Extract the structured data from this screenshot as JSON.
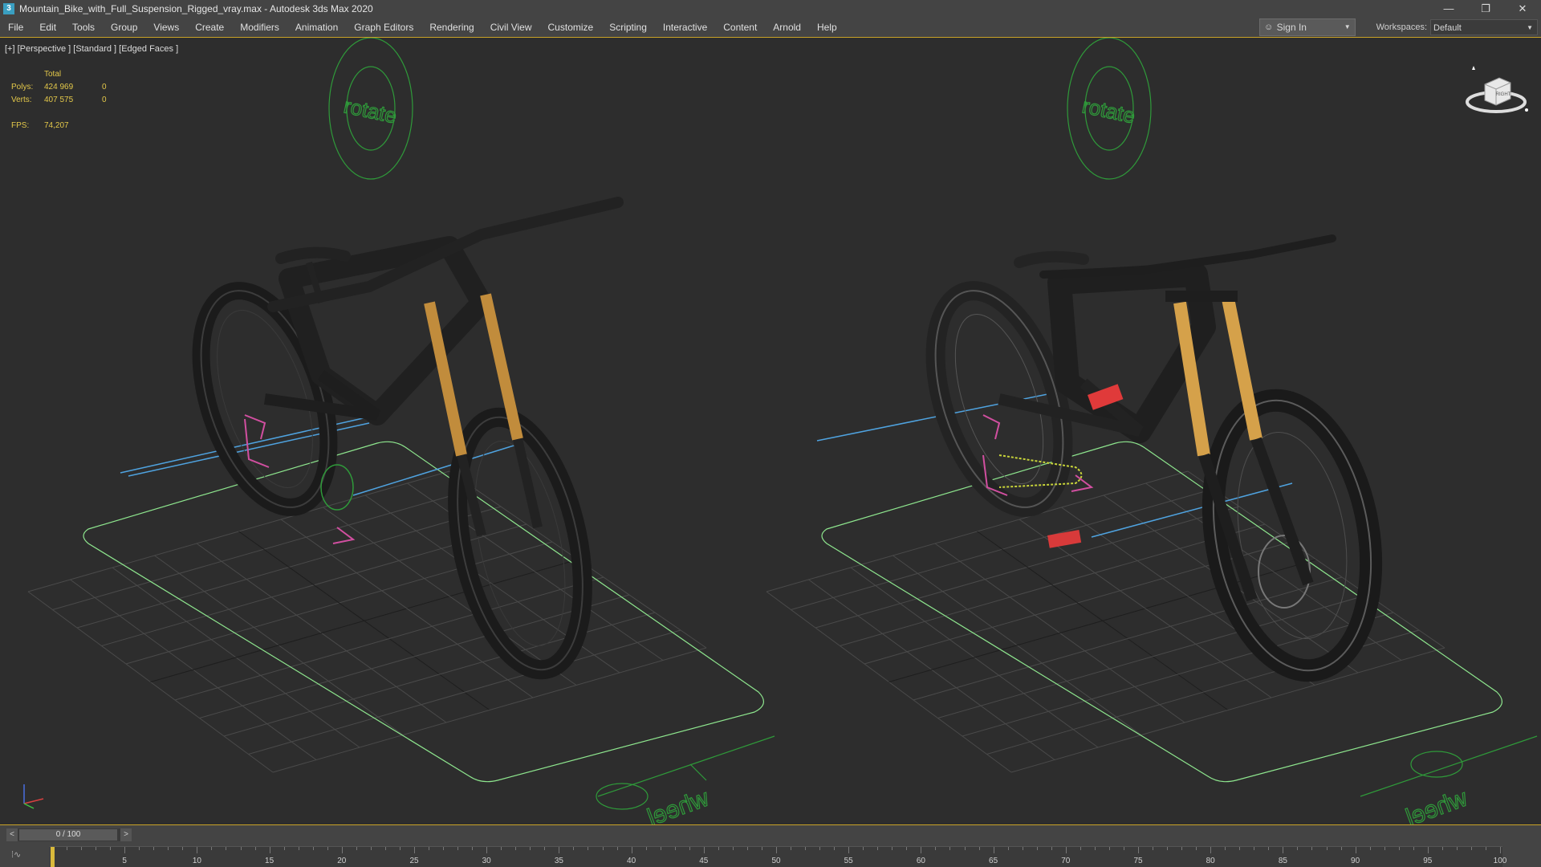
{
  "window": {
    "title": "Mountain_Bike_with_Full_Suspension_Rigged_vray.max - Autodesk 3ds Max 2020",
    "app_icon": "3",
    "controls": {
      "minimize": "—",
      "restore": "❐",
      "close": "✕"
    }
  },
  "menu": {
    "items": [
      "File",
      "Edit",
      "Tools",
      "Group",
      "Views",
      "Create",
      "Modifiers",
      "Animation",
      "Graph Editors",
      "Rendering",
      "Civil View",
      "Customize",
      "Scripting",
      "Interactive",
      "Content",
      "Arnold",
      "Help"
    ],
    "sign_in": "Sign In",
    "workspaces_label": "Workspaces:",
    "workspace_value": "Default"
  },
  "viewport": {
    "label": "[+] [Perspective ] [Standard ] [Edged Faces ]",
    "stats": {
      "total_label": "Total",
      "polys_label": "Polys:",
      "polys_value": "424 969",
      "polys_sel": "0",
      "verts_label": "Verts:",
      "verts_value": "407 575",
      "verts_sel": "0",
      "fps_label": "FPS:",
      "fps_value": "74,207"
    },
    "viewcube_label": "RIGHT",
    "rotate_text": "rotate",
    "wheel_text": "wheel"
  },
  "timeline": {
    "position": "0 / 100",
    "prev": "<",
    "next": ">",
    "curve_icon": "⁞∿",
    "ticks": [
      5,
      10,
      15,
      20,
      25,
      30,
      35,
      40,
      45,
      50,
      55,
      60,
      65,
      70,
      75,
      80,
      85,
      90,
      95,
      100
    ],
    "max_frame": 100,
    "current_frame": 0
  },
  "colors": {
    "accent": "#c9a227",
    "helper_green": "#2f9a3a",
    "bone_blue": "#4fa3e0",
    "ground_helper": "#8ee68e",
    "fork_orange": "#d5a14a"
  }
}
